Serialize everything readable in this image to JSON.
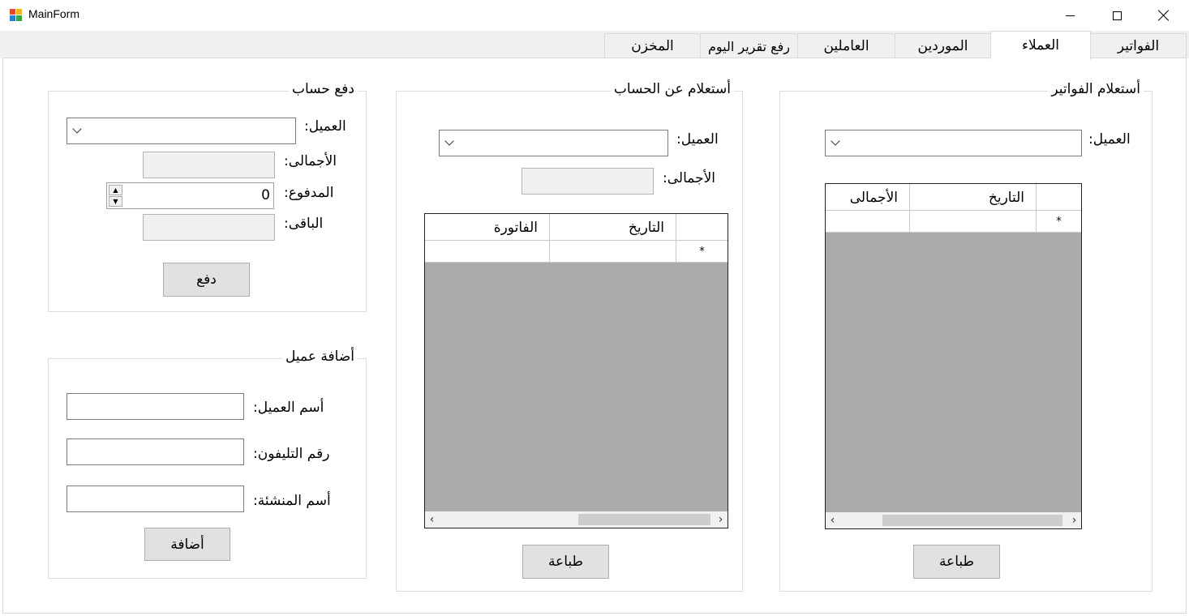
{
  "window": {
    "title": "MainForm"
  },
  "tabs": [
    "الفواتير",
    "العملاء",
    "الموردين",
    "العاملين",
    "رفع تقرير اليوم",
    "المخزن"
  ],
  "invoice_inquiry": {
    "title": "أستعلام الفواتير",
    "customer_label": "العميل:",
    "grid_columns": [
      "التاريخ",
      "الأجمالى"
    ],
    "new_row_marker": "*",
    "print_label": "طباعة"
  },
  "account_inquiry": {
    "title": "أستعلام عن الحساب",
    "customer_label": "العميل:",
    "total_label": "الأجمالى:",
    "grid_columns": [
      "التاريخ",
      "الفاتورة"
    ],
    "new_row_marker": "*",
    "print_label": "طباعة"
  },
  "pay_account": {
    "title": "دفع حساب",
    "customer_label": "العميل:",
    "total_label": "الأجمالى:",
    "paid_label": "المدفوع:",
    "paid_value": "0",
    "remaining_label": "الباقى:",
    "pay_label": "دفع"
  },
  "add_customer": {
    "title": "أضافة عميل",
    "name_label": "أسم العميل:",
    "phone_label": "رقم التليفون:",
    "company_label": "أسم المنشئة:",
    "add_label": "أضافة"
  }
}
